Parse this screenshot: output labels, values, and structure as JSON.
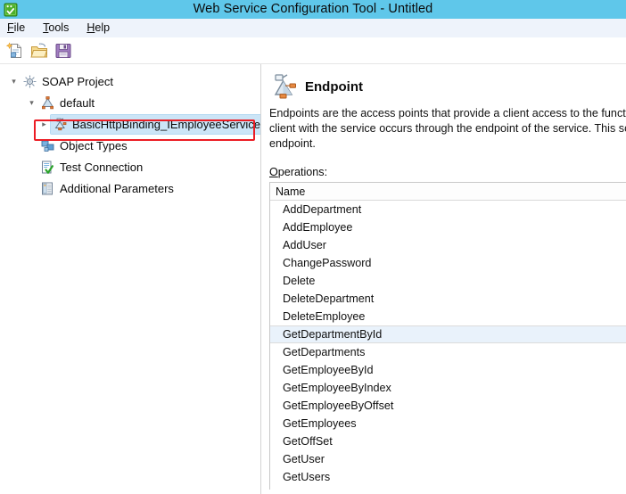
{
  "window": {
    "title": "Web Service Configuration Tool - Untitled",
    "icon": "app-green-check-icon",
    "titlebar_color": "#5fc7ea"
  },
  "menubar": {
    "items": [
      {
        "label": "File",
        "accelerator": "F"
      },
      {
        "label": "Tools",
        "accelerator": "T"
      },
      {
        "label": "Help",
        "accelerator": "H"
      }
    ]
  },
  "toolbar": {
    "buttons": [
      {
        "name": "new-document-icon",
        "tooltip": "New"
      },
      {
        "name": "open-folder-icon",
        "tooltip": "Open"
      },
      {
        "name": "save-floppy-icon",
        "tooltip": "Save"
      }
    ]
  },
  "tree": {
    "nodes": [
      {
        "label": "SOAP Project",
        "icon": "soap-project-icon",
        "indent": 0,
        "twisty": "expanded",
        "selected": false
      },
      {
        "label": "default",
        "icon": "binding-default-icon",
        "indent": 1,
        "twisty": "expanded",
        "selected": false
      },
      {
        "label": "BasicHttpBinding_IEmployeeService",
        "icon": "endpoint-small-icon",
        "indent": 2,
        "twisty": "collapsed",
        "selected": true
      },
      {
        "label": "Object Types",
        "icon": "object-types-icon",
        "indent": 1,
        "twisty": "none",
        "selected": false
      },
      {
        "label": "Test Connection",
        "icon": "test-connection-icon",
        "indent": 1,
        "twisty": "none",
        "selected": false
      },
      {
        "label": "Additional Parameters",
        "icon": "additional-parameters-icon",
        "indent": 1,
        "twisty": "none",
        "selected": false
      }
    ],
    "annotation_color": "#ec1c24"
  },
  "detail": {
    "icon": "endpoint-large-icon",
    "title": "Endpoint",
    "description": "Endpoints are the access points that provide a client access to the functiona\nclient with the service occurs through the endpoint of the service. This scree\nendpoint.",
    "operations_label": "Operations:",
    "operations_label_accelerator": "O",
    "columns": [
      "Name"
    ],
    "operations": [
      {
        "name": "AddDepartment",
        "selected": false
      },
      {
        "name": "AddEmployee",
        "selected": false
      },
      {
        "name": "AddUser",
        "selected": false
      },
      {
        "name": "ChangePassword",
        "selected": false
      },
      {
        "name": "Delete",
        "selected": false
      },
      {
        "name": "DeleteDepartment",
        "selected": false
      },
      {
        "name": "DeleteEmployee",
        "selected": false
      },
      {
        "name": "GetDepartmentById",
        "selected": true
      },
      {
        "name": "GetDepartments",
        "selected": false
      },
      {
        "name": "GetEmployeeById",
        "selected": false
      },
      {
        "name": "GetEmployeeByIndex",
        "selected": false
      },
      {
        "name": "GetEmployeeByOffset",
        "selected": false
      },
      {
        "name": "GetEmployees",
        "selected": false
      },
      {
        "name": "GetOffSet",
        "selected": false
      },
      {
        "name": "GetUser",
        "selected": false
      },
      {
        "name": "GetUsers",
        "selected": false
      }
    ]
  }
}
